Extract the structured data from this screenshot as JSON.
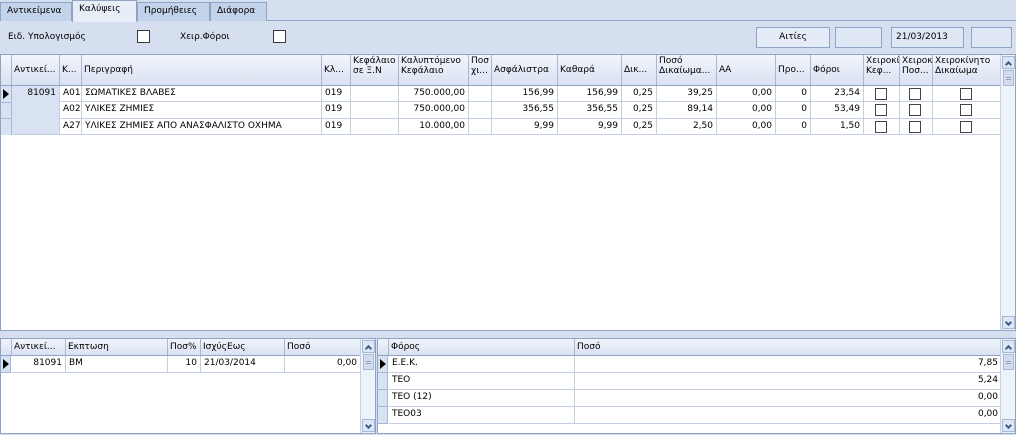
{
  "tabs": [
    "Αντικείμενα",
    "Καλύψεις",
    "Προμήθειες",
    "Διάφορα"
  ],
  "toolbar": {
    "special_calc_label": "Ειδ. Υπολογισμός",
    "manual_tax_label": "Χειρ.Φόροι",
    "aities_button": "Αιτίες",
    "date_value": "21/03/2013"
  },
  "coverage_grid": {
    "headers": [
      "Αντικεί...",
      "Κ...",
      "Περιγραφή",
      "Κλ...",
      "Κεφάλαιο σε Ξ.Ν",
      "Καλυπτόμενο Κεφάλαιο",
      "Ποσ χι...",
      "Ασφάλιστρα",
      "Καθαρά",
      "Δικ...",
      "Ποσό Δικαίωμα...",
      "ΑΑ",
      "Προ...",
      "Φόροι",
      "Χειροκί Κεφ...",
      "Χειροκί Ποσ...",
      "Χειροκίνητο Δικαίωμα"
    ],
    "object_id": "81091",
    "rows": [
      {
        "code": "A01",
        "description": "ΣΩΜΑΤΙΚΕΣ ΒΛΑΒΕΣ",
        "class": "019",
        "capital": "750.000,00",
        "premium": "156,99",
        "net": "156,99",
        "rate": "0,25",
        "fee": "39,25",
        "aa": "0,00",
        "pro": "0",
        "taxes": "23,54"
      },
      {
        "code": "A02",
        "description": "ΥΛΙΚΕΣ ΖΗΜΙΕΣ",
        "class": "019",
        "capital": "750.000,00",
        "premium": "356,55",
        "net": "356,55",
        "rate": "0,25",
        "fee": "89,14",
        "aa": "0,00",
        "pro": "0",
        "taxes": "53,49"
      },
      {
        "code": "A27",
        "description": "ΥΛΙΚΕΣ ΖΗΜΙΕΣ ΑΠΟ ΑΝΑΣΦΑΛΙΣΤΟ ΟΧΗΜΑ",
        "class": "019",
        "capital": "10.000,00",
        "premium": "9,99",
        "net": "9,99",
        "rate": "0,25",
        "fee": "2,50",
        "aa": "0,00",
        "pro": "0",
        "taxes": "1,50"
      }
    ]
  },
  "discount_grid": {
    "headers": [
      "Αντικεί...",
      "Εκπτωση",
      "Ποσ%",
      "ΙσχύςΕως",
      "Ποσό"
    ],
    "rows": [
      {
        "object": "81091",
        "discount": "ΒΜ",
        "pct": "10",
        "valid_until": "21/03/2014",
        "amount": "0,00"
      }
    ]
  },
  "tax_grid": {
    "headers": [
      "Φόρος",
      "Ποσό"
    ],
    "rows": [
      {
        "tax": "Ε.Ε.Κ.",
        "amount": "7,85"
      },
      {
        "tax": "ΤΕΟ",
        "amount": "5,24"
      },
      {
        "tax": "ΤΕΟ (12)",
        "amount": "0,00"
      },
      {
        "tax": "ΤΕΟ03",
        "amount": "0,00"
      }
    ]
  }
}
